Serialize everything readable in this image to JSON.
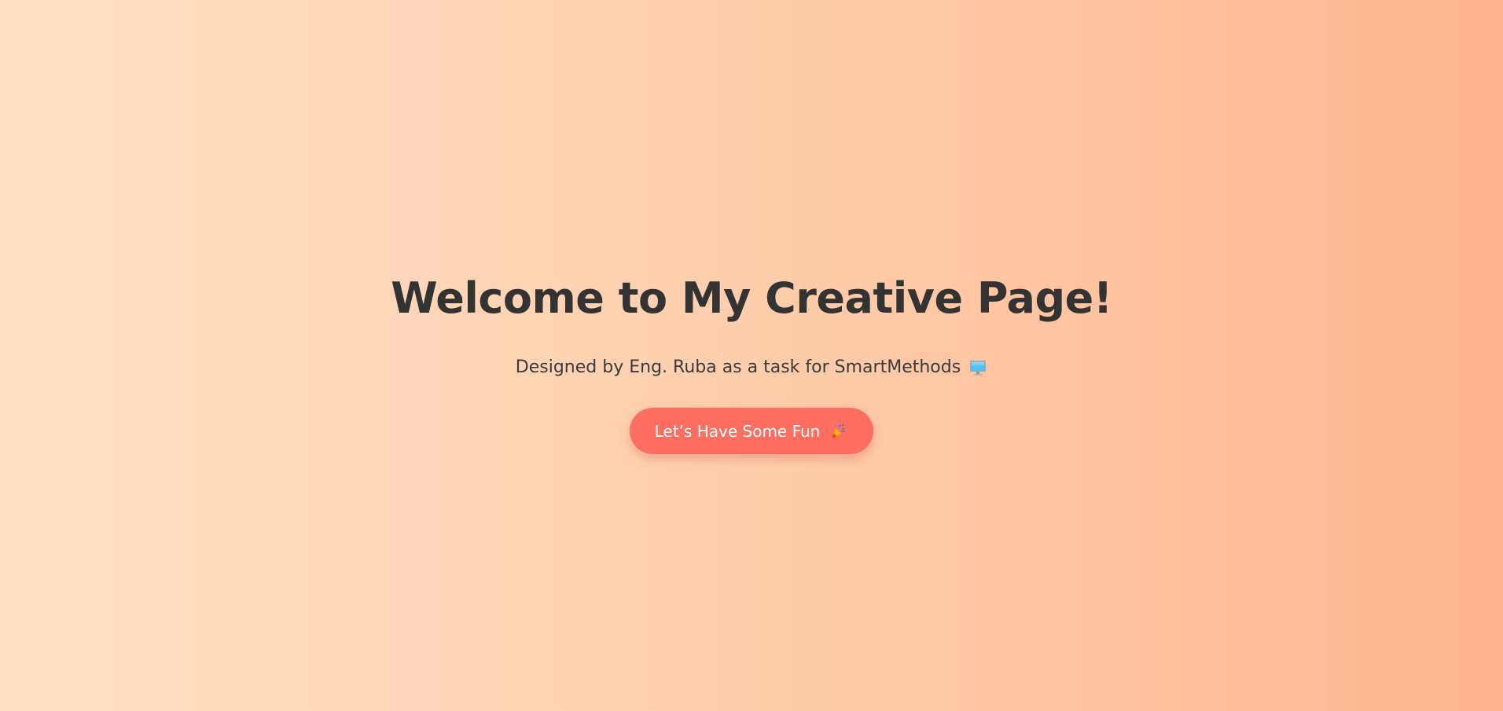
{
  "page": {
    "title": "Welcome to My Creative Page!",
    "subtitle": "Designed by Eng. Ruba as a task for SmartMethods",
    "subtitle_icon": "computer-icon",
    "cta_label": "Let’s Have Some Fun",
    "cta_icon": "party-popper-icon"
  },
  "colors": {
    "background_start": "#ffe0c4",
    "background_end": "#ffb68e",
    "text": "#333333",
    "button": "#ff6f61",
    "button_text": "#ffffff"
  }
}
